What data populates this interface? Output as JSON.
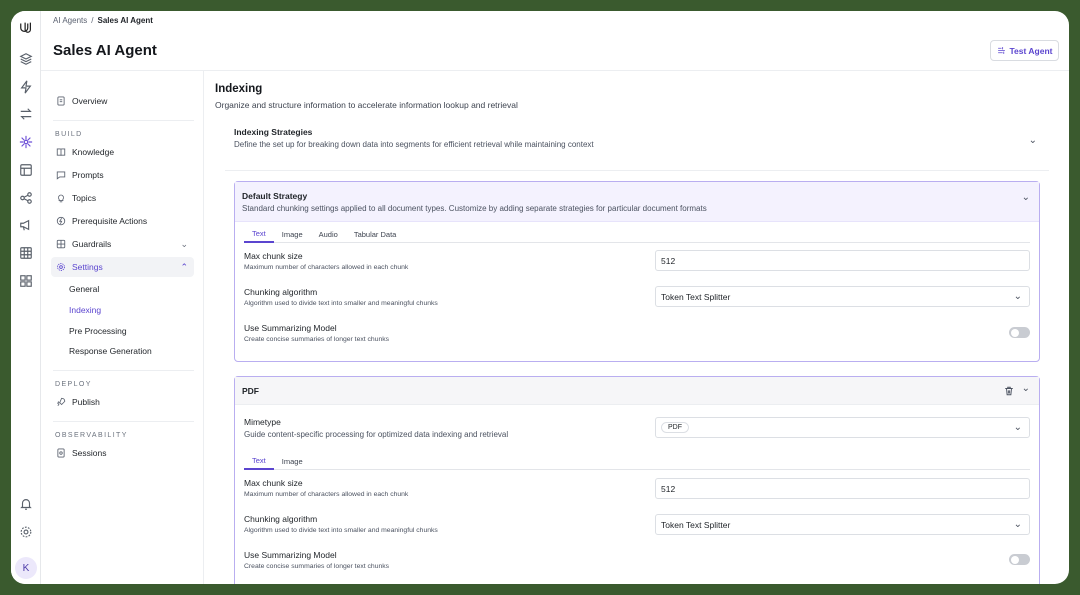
{
  "breadcrumb": {
    "parent": "AI Agents",
    "separator": "/",
    "current": "Sales AI Agent"
  },
  "header": {
    "title": "Sales AI Agent",
    "test_button": "Test Agent"
  },
  "rail": {
    "icons": [
      "logo-icon",
      "layers-icon",
      "bolt-icon",
      "arrows-icon",
      "agents-icon",
      "layout-icon",
      "share-icon",
      "megaphone-icon",
      "table-icon",
      "grid-icon",
      "bell-icon",
      "gear-icon"
    ],
    "avatar": "K"
  },
  "nav": {
    "overview": "Overview",
    "build_section": "BUILD",
    "knowledge": "Knowledge",
    "prompts": "Prompts",
    "topics": "Topics",
    "prerequisite": "Prerequisite Actions",
    "guardrails": "Guardrails",
    "settings": "Settings",
    "settings_sub": [
      "General",
      "Indexing",
      "Pre Processing",
      "Response Generation"
    ],
    "deploy_section": "DEPLOY",
    "publish": "Publish",
    "observability_section": "OBSERVABILITY",
    "sessions": "Sessions"
  },
  "main": {
    "title": "Indexing",
    "description": "Organize and structure information to accelerate information lookup and retrieval",
    "strategies": {
      "title": "Indexing Strategies",
      "description": "Define the set up for breaking down data into segments for efficient retrieval while maintaining context"
    },
    "default_card": {
      "title": "Default Strategy",
      "description": "Standard chunking settings applied to all document types. Customize by adding separate strategies for particular document formats",
      "tabs": [
        "Text",
        "Image",
        "Audio",
        "Tabular Data"
      ],
      "max_chunk_label": "Max chunk size",
      "max_chunk_sub": "Maximum number of characters allowed in each chunk",
      "max_chunk_value": "512",
      "algo_label": "Chunking algorithm",
      "algo_sub": "Algorithm used to divide text into smaller and meaningful chunks",
      "algo_value": "Token Text Splitter",
      "summ_label": "Use Summarizing Model",
      "summ_sub": "Create concise summaries of longer text chunks"
    },
    "pdf_card": {
      "title": "PDF",
      "mimetype_label": "Mimetype",
      "mimetype_sub": "Guide content-specific processing for optimized data indexing and retrieval",
      "mimetype_value": "PDF",
      "tabs": [
        "Text",
        "Image"
      ],
      "max_chunk_label": "Max chunk size",
      "max_chunk_sub": "Maximum number of characters allowed in each chunk",
      "max_chunk_value": "512",
      "algo_label": "Chunking algorithm",
      "algo_sub": "Algorithm used to divide text into smaller and meaningful chunks",
      "algo_value": "Token Text Splitter",
      "summ_label": "Use Summarizing Model",
      "summ_sub": "Create concise summaries of longer text chunks"
    }
  },
  "colors": {
    "accent": "#5b45cf",
    "frame": "#3a5a2e"
  }
}
